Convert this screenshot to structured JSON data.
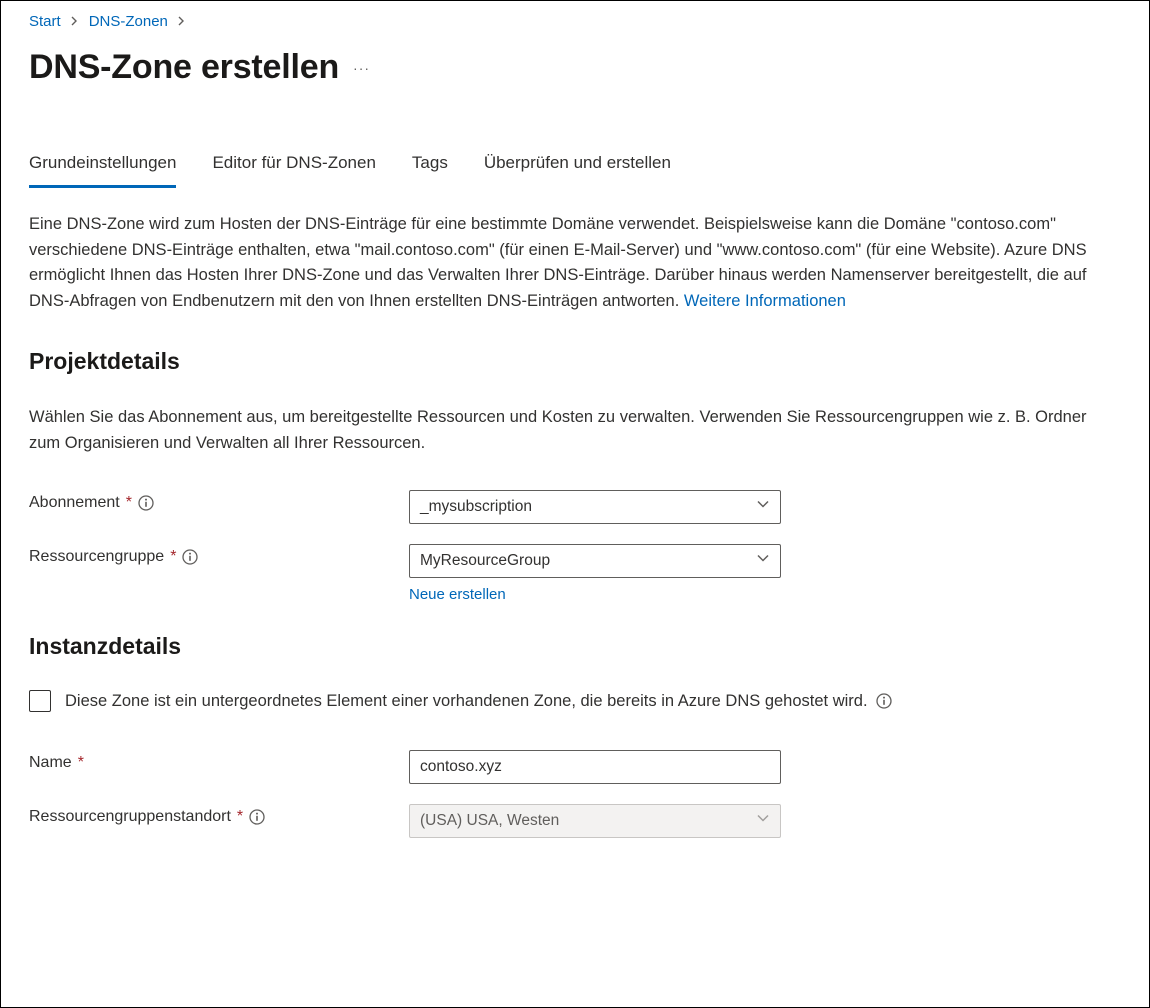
{
  "breadcrumb": {
    "items": [
      "Start",
      "DNS-Zonen"
    ]
  },
  "page": {
    "title": "DNS-Zone erstellen"
  },
  "tabs": {
    "items": [
      "Grundeinstellungen",
      "Editor für DNS-Zonen",
      "Tags",
      "Überprüfen und erstellen"
    ],
    "active_index": 0
  },
  "description": {
    "text": "Eine DNS-Zone wird zum Hosten der DNS-Einträge für eine bestimmte Domäne verwendet. Beispielsweise kann die Domäne \"contoso.com\" verschiedene DNS-Einträge enthalten, etwa \"mail.contoso.com\" (für einen E-Mail-Server) und \"www.contoso.com\" (für eine Website). Azure DNS ermöglicht Ihnen das Hosten Ihrer DNS-Zone und das Verwalten Ihrer DNS-Einträge. Darüber hinaus werden Namenserver bereitgestellt, die auf DNS-Abfragen von Endbenutzern mit den von Ihnen erstellten DNS-Einträgen antworten. ",
    "link": "Weitere Informationen"
  },
  "sections": {
    "project": {
      "heading": "Projektdetails",
      "desc": "Wählen Sie das Abonnement aus, um bereitgestellte Ressourcen und Kosten zu verwalten. Verwenden Sie Ressourcengruppen wie z. B. Ordner zum Organisieren und Verwalten all Ihrer Ressourcen.",
      "subscription_label": "Abonnement",
      "subscription_value": "_mysubscription",
      "resourcegroup_label": "Ressourcengruppe",
      "resourcegroup_value": "MyResourceGroup",
      "create_new": "Neue erstellen"
    },
    "instance": {
      "heading": "Instanzdetails",
      "child_zone_label": "Diese Zone ist ein untergeordnetes Element einer vorhandenen Zone, die bereits in Azure DNS gehostet wird.",
      "name_label": "Name",
      "name_value": "contoso.xyz",
      "location_label": "Ressourcengruppenstandort",
      "location_value": "(USA) USA, Westen"
    }
  }
}
